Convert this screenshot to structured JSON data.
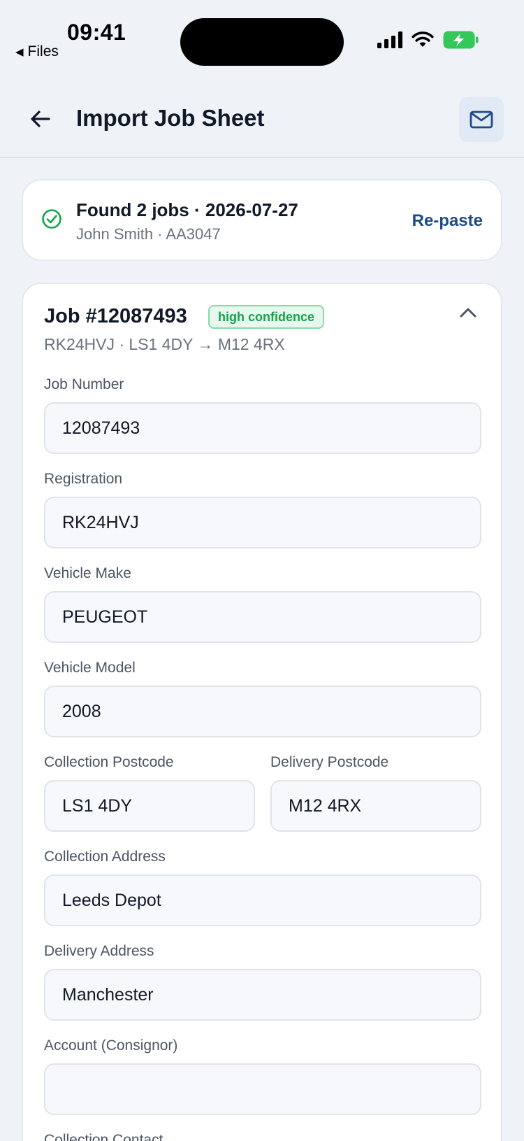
{
  "status_bar": {
    "time": "09:41",
    "back_app": "Files",
    "back_icon": "triangle-left-icon",
    "icons": [
      "signal-icon",
      "wifi-icon",
      "battery-charging-icon"
    ]
  },
  "header": {
    "title": "Import Job Sheet",
    "back_icon": "arrow-left-icon",
    "action_icon": "mail-icon"
  },
  "summary": {
    "title": "Found 2 jobs · 2026-07-27",
    "subtitle": "John Smith · AA3047",
    "action": "Re-paste",
    "icon": "check-circle-icon",
    "accent": "#16a34a"
  },
  "job": {
    "title": "Job #12087493",
    "badge": "high confidence",
    "subtitle": "RK24HVJ · LS1 4DY → M12 4RX",
    "toggle_icon": "chevron-up-icon",
    "fields": {
      "job_number": {
        "label": "Job Number",
        "value": "12087493"
      },
      "registration": {
        "label": "Registration",
        "value": "RK24HVJ"
      },
      "vehicle_make": {
        "label": "Vehicle Make",
        "value": "PEUGEOT"
      },
      "vehicle_model": {
        "label": "Vehicle Model",
        "value": "2008"
      },
      "collection_postcode": {
        "label": "Collection Postcode",
        "value": "LS1 4DY"
      },
      "delivery_postcode": {
        "label": "Delivery Postcode",
        "value": "M12 4RX"
      },
      "collection_address": {
        "label": "Collection Address",
        "value": "Leeds Depot"
      },
      "delivery_address": {
        "label": "Delivery Address",
        "value": "Manchester"
      },
      "account": {
        "label": "Account (Consignor)",
        "value": ""
      },
      "collection_contact": {
        "label": "Collection Contact"
      }
    }
  },
  "colors": {
    "background": "#eff3f8",
    "card": "#ffffff",
    "link": "#1e4b86",
    "success": "#16a34a",
    "battery": "#34c759"
  }
}
